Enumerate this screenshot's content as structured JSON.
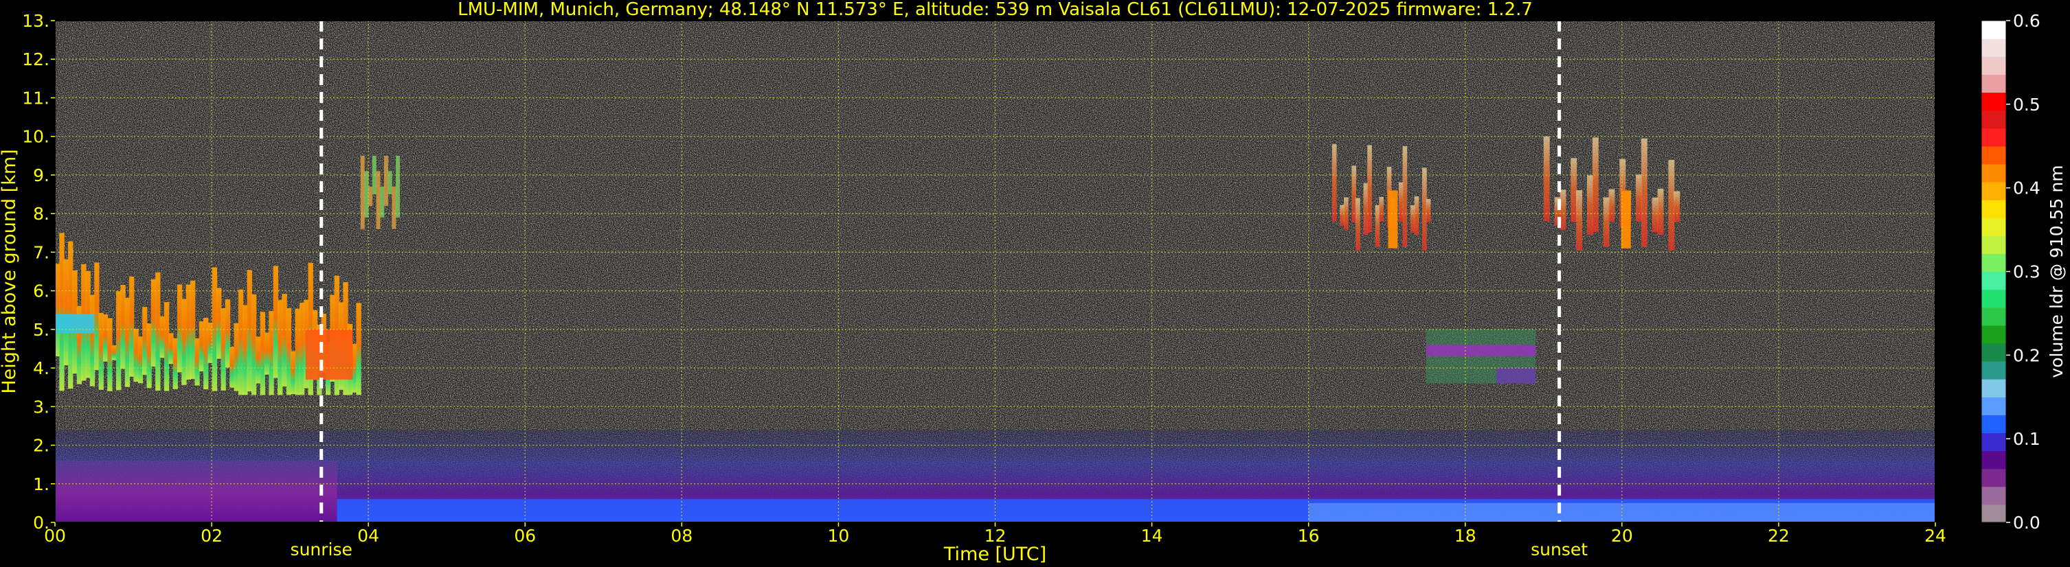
{
  "chart_data": {
    "type": "heatmap",
    "title": "LMU-MIM, Munich, Germany; 48.148° N 11.573° E, altitude: 539 m    Vaisala CL61 (CL61LMU): 12-07-2025    firmware: 1.2.7",
    "xlabel": "Time [UTC]",
    "ylabel": "Height above ground [km]",
    "xlim": [
      0,
      24
    ],
    "ylim": [
      0,
      13
    ],
    "xticks": [
      "00",
      "02",
      "04",
      "06",
      "08",
      "10",
      "12",
      "14",
      "16",
      "18",
      "20",
      "22",
      "24"
    ],
    "xtick_values": [
      0,
      2,
      4,
      6,
      8,
      10,
      12,
      14,
      16,
      18,
      20,
      22,
      24
    ],
    "yticks": [
      "0.",
      "1.",
      "2.",
      "3.",
      "4.",
      "5.",
      "6.",
      "7.",
      "8.",
      "9.",
      "10.",
      "11.",
      "12.",
      "13."
    ],
    "ytick_values": [
      0,
      1,
      2,
      3,
      4,
      5,
      6,
      7,
      8,
      9,
      10,
      11,
      12,
      13
    ],
    "grid": true,
    "markers": [
      {
        "label": "sunrise",
        "time": 3.4
      },
      {
        "label": "sunset",
        "time": 19.2
      }
    ],
    "colorbar": {
      "label": "volume ldr @ 910.55 nm",
      "range": [
        0.0,
        0.6
      ],
      "ticks": [
        "0.0",
        "0.1",
        "0.2",
        "0.3",
        "0.4",
        "0.5",
        "0.6"
      ],
      "tick_values": [
        0.0,
        0.1,
        0.2,
        0.3,
        0.4,
        0.5,
        0.6
      ],
      "colors": [
        "#a08c98",
        "#9b6b9e",
        "#7d2a8e",
        "#5a0a8a",
        "#3a2ad0",
        "#2060ff",
        "#5a9cff",
        "#82c8e8",
        "#2a9a8a",
        "#1a8a4a",
        "#1aa01a",
        "#2cc84a",
        "#20e070",
        "#48f0a0",
        "#7af060",
        "#c0f040",
        "#e8f028",
        "#ffe000",
        "#ffb000",
        "#ff8c00",
        "#ff5a00",
        "#ff2020",
        "#e01818",
        "#ff0000",
        "#e8a0a0",
        "#f0c8c8",
        "#f0e0e0",
        "#ffffff"
      ]
    },
    "features": [
      {
        "name": "aerosol-boundary-layer",
        "t0": 0,
        "t1": 24,
        "h0": 0,
        "h1": 2.4,
        "ldr": 0.08
      },
      {
        "name": "ice-cloud-morning",
        "t0": 0,
        "t1": 3.9,
        "h0": 3.3,
        "h1": 7.5,
        "ldr": 0.32
      },
      {
        "name": "cloud-0430",
        "t0": 3.9,
        "t1": 4.4,
        "h0": 7.6,
        "h1": 9.5,
        "ldr": 0.2
      },
      {
        "name": "cirrus-afternoon",
        "t0": 16.3,
        "t1": 17.6,
        "h0": 7.0,
        "h1": 9.8,
        "ldr": 0.42
      },
      {
        "name": "midlevel-layer",
        "t0": 17.5,
        "t1": 18.9,
        "h0": 3.6,
        "h1": 5.0,
        "ldr": 0.12
      },
      {
        "name": "cirrus-evening",
        "t0": 19.0,
        "t1": 20.8,
        "h0": 7.0,
        "h1": 10.0,
        "ldr": 0.42
      }
    ]
  }
}
